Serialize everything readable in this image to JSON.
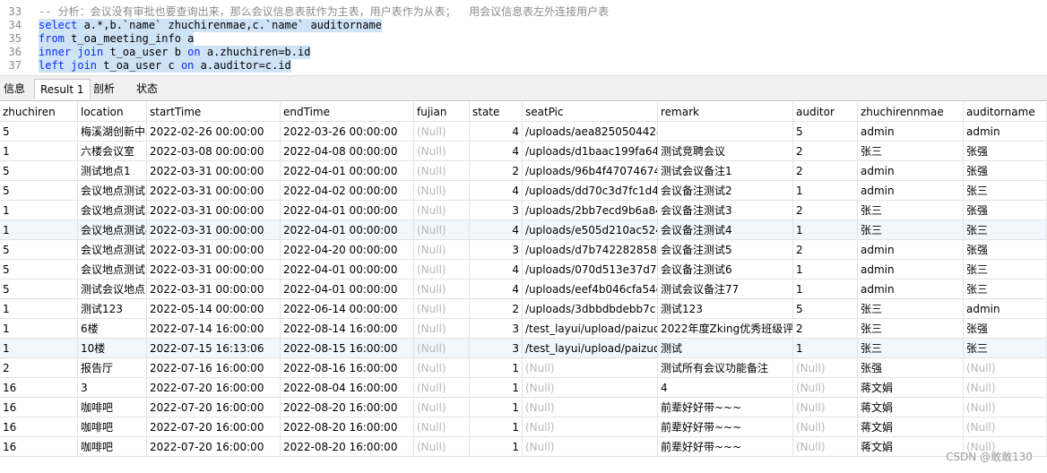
{
  "editor": {
    "lines": [
      {
        "num": "33",
        "parts": [
          {
            "t": "-- 分析：会议没有审批也要查询出来，那么会议信息表就作为主表，用户表作为从表；  用会议信息表左外连接用户表",
            "c": "comment"
          }
        ],
        "selected": false
      },
      {
        "num": "34",
        "parts": [
          {
            "t": "select",
            "c": "kw"
          },
          {
            "t": " a.*,b.`name` zhuchirenmae,c.`name` auditorname",
            "c": ""
          }
        ],
        "selected": true
      },
      {
        "num": "35",
        "parts": [
          {
            "t": "from",
            "c": "kw"
          },
          {
            "t": " t_oa_meeting_info a",
            "c": ""
          }
        ],
        "selected": true
      },
      {
        "num": "36",
        "parts": [
          {
            "t": "inner join",
            "c": "kw"
          },
          {
            "t": " t_oa_user b ",
            "c": ""
          },
          {
            "t": "on",
            "c": "kw"
          },
          {
            "t": " a.zhuchiren=b.id",
            "c": ""
          }
        ],
        "selected": true
      },
      {
        "num": "37",
        "parts": [
          {
            "t": "left join",
            "c": "kw"
          },
          {
            "t": " t_oa_user c ",
            "c": ""
          },
          {
            "t": "on",
            "c": "kw"
          },
          {
            "t": " a.auditor=c.id",
            "c": ""
          }
        ],
        "selected": true
      }
    ]
  },
  "tabs": [
    "信息",
    "Result 1",
    "剖析",
    "状态"
  ],
  "active_tab": "Result 1",
  "columns": [
    "zhuchiren",
    "location",
    "startTime",
    "endTime",
    "fujian",
    "state",
    "seatPic",
    "remark",
    "auditor",
    "zhuchirennmae",
    "auditorname"
  ],
  "null_text": "(Null)",
  "rows": [
    [
      "5",
      "梅溪湖创新中心",
      "2022-02-26 00:00:00",
      "2022-03-26 00:00:00",
      "(Null)",
      "4",
      "/uploads/aea8250504424",
      "",
      "5",
      "admin",
      "admin"
    ],
    [
      "1",
      "六楼会议室",
      "2022-03-08 00:00:00",
      "2022-04-08 00:00:00",
      "(Null)",
      "4",
      "/uploads/d1baac199fa644",
      "测试竞聘会议",
      "2",
      "张三",
      "张强"
    ],
    [
      "5",
      "测试地点1",
      "2022-03-31 00:00:00",
      "2022-04-01 00:00:00",
      "(Null)",
      "2",
      "/uploads/96b4f47074674",
      "测试会议备注1",
      "2",
      "admin",
      "张强"
    ],
    [
      "5",
      "会议地点测试2",
      "2022-03-31 00:00:00",
      "2022-04-02 00:00:00",
      "(Null)",
      "4",
      "/uploads/dd70c3d7fc1d4",
      "会议备注测试2",
      "1",
      "admin",
      "张三"
    ],
    [
      "1",
      "会议地点测试3",
      "2022-03-31 00:00:00",
      "2022-04-01 00:00:00",
      "(Null)",
      "3",
      "/uploads/2bb7ecd9b6a84",
      "会议备注测试3",
      "2",
      "张三",
      "张强"
    ],
    [
      "1",
      "会议地点测试4",
      "2022-03-31 00:00:00",
      "2022-04-01 00:00:00",
      "(Null)",
      "4",
      "/uploads/e505d210ac524",
      "会议备注测试4",
      "1",
      "张三",
      "张三"
    ],
    [
      "5",
      "会议地点测试5",
      "2022-03-31 00:00:00",
      "2022-04-20 00:00:00",
      "(Null)",
      "3",
      "/uploads/d7b7422828584",
      "会议备注测试5",
      "2",
      "admin",
      "张强"
    ],
    [
      "5",
      " 会议地点测试6",
      "2022-03-31 00:00:00",
      "2022-04-01 00:00:00",
      "(Null)",
      "4",
      "/uploads/070d513e37d74",
      " 会议备注测试6",
      "1",
      "admin",
      "张三"
    ],
    [
      "5",
      "测试会议地点7",
      "2022-03-31 00:00:00",
      "2022-04-01 00:00:00",
      "(Null)",
      "4",
      "/uploads/eef4b046cfa54d",
      "测试会议备注77",
      "1",
      "admin",
      "张三"
    ],
    [
      "1",
      "测试123",
      "2022-05-14 00:00:00",
      "2022-06-14 00:00:00",
      "(Null)",
      "2",
      "/uploads/3dbbdbdebb7c",
      "测试123",
      "5",
      "张三",
      "admin"
    ],
    [
      "1",
      "6楼",
      "2022-07-14 16:00:00",
      "2022-08-14 16:00:00",
      "(Null)",
      "3",
      "/test_layui/upload/paizuo",
      "2022年度Zking优秀班级评选",
      "2",
      "张三",
      "张强"
    ],
    [
      "1",
      "10楼",
      "2022-07-15 16:13:06",
      "2022-08-15 16:00:00",
      "(Null)",
      "3",
      "/test_layui/upload/paizuo",
      "测试",
      "1",
      "张三",
      "张三"
    ],
    [
      "2",
      "报告厅",
      "2022-07-16 16:00:00",
      "2022-08-16 16:00:00",
      "(Null)",
      "1",
      "(Null)",
      "测试所有会议功能备注",
      "(Null)",
      "张强",
      "(Null)"
    ],
    [
      "16",
      "3",
      "2022-07-20 16:00:00",
      "2022-08-04 16:00:00",
      "(Null)",
      "1",
      "(Null)",
      "4",
      "(Null)",
      "蒋文娟",
      "(Null)"
    ],
    [
      "16",
      "咖啡吧",
      "2022-07-20 16:00:00",
      "2022-08-20 16:00:00",
      "(Null)",
      "1",
      "(Null)",
      "前辈好好带~~~",
      "(Null)",
      "蒋文娟",
      "(Null)"
    ],
    [
      "16",
      "咖啡吧",
      "2022-07-20 16:00:00",
      "2022-08-20 16:00:00",
      "(Null)",
      "1",
      "(Null)",
      "前辈好好带~~~",
      "(Null)",
      "蒋文娟",
      "(Null)"
    ],
    [
      "16",
      "咖啡吧",
      "2022-07-20 16:00:00",
      "2022-08-20 16:00:00",
      "(Null)",
      "1",
      "(Null)",
      "前辈好好带~~~",
      "(Null)",
      "蒋文娟",
      "(Null)"
    ]
  ],
  "watermark": "CSDN @敢敢130",
  "colors": {
    "keyword": "#0a2bff",
    "comment": "#8c8c8c",
    "selection": "#cfe3f7",
    "null": "#b8b8b8",
    "alt_row": "#f1f7fc"
  }
}
